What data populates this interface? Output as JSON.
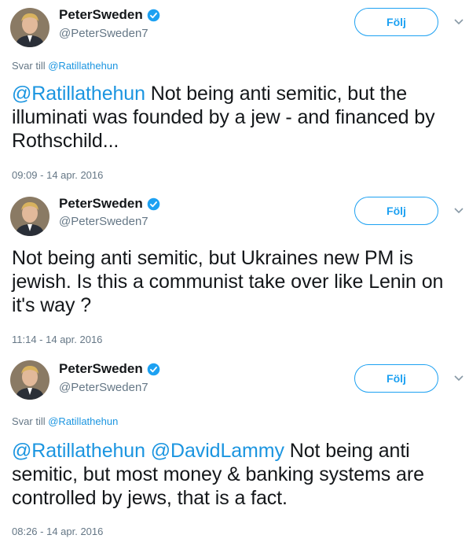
{
  "colors": {
    "accent": "#1da1f2",
    "mention": "#1b95e0",
    "text": "#14171a",
    "secondary": "#657786"
  },
  "tweets": [
    {
      "user": {
        "name": "PeterSweden",
        "handle": "@PeterSweden7",
        "verified_icon": "verified-badge-icon",
        "avatar_icon": "profile-avatar"
      },
      "follow_label": "Följ",
      "menu_icon": "chevron-down-icon",
      "reply_prefix": "Svar till ",
      "reply_mention": "@Ratillathehun",
      "mentions": "@Ratillathehun",
      "text": " Not being anti semitic, but the illuminati was founded by a jew - and financed by Rothschild...",
      "timestamp": "09:09 - 14 apr. 2016"
    },
    {
      "user": {
        "name": "PeterSweden",
        "handle": "@PeterSweden7",
        "verified_icon": "verified-badge-icon",
        "avatar_icon": "profile-avatar"
      },
      "follow_label": "Följ",
      "menu_icon": "chevron-down-icon",
      "text": "Not being anti semitic, but Ukraines new PM is jewish. Is this a communist take over like Lenin on it's way ?",
      "timestamp": "11:14 - 14 apr. 2016"
    },
    {
      "user": {
        "name": "PeterSweden",
        "handle": "@PeterSweden7",
        "verified_icon": "verified-badge-icon",
        "avatar_icon": "profile-avatar"
      },
      "follow_label": "Följ",
      "menu_icon": "chevron-down-icon",
      "reply_prefix": "Svar till ",
      "reply_mention": "@Ratillathehun",
      "mentions": "@Ratillathehun @DavidLammy",
      "text": " Not being anti semitic, but most money & banking systems are controlled by jews, that is a fact.",
      "timestamp": "08:26 - 14 apr. 2016"
    }
  ]
}
